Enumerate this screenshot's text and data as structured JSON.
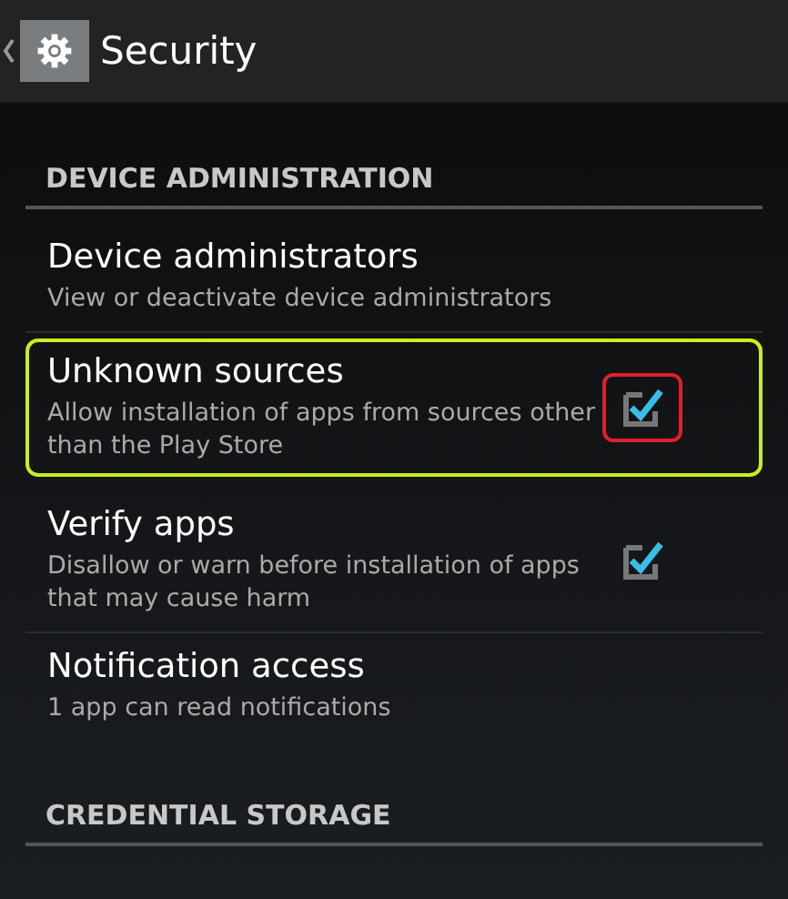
{
  "action_bar": {
    "title": "Security"
  },
  "sections": [
    {
      "header": "DEVICE ADMINISTRATION",
      "items": [
        {
          "kind": "link",
          "title": "Device administrators",
          "summary": "View or deactivate device administrators",
          "highlighted": false
        },
        {
          "kind": "checkbox",
          "title": "Unknown sources",
          "summary": "Allow installation of apps from sources other than the Play Store",
          "checked": true,
          "highlighted": true
        },
        {
          "kind": "checkbox",
          "title": "Verify apps",
          "summary": "Disallow or warn before installation of apps that may cause harm",
          "checked": true,
          "highlighted": false
        },
        {
          "kind": "link",
          "title": "Notification access",
          "summary": "1 app can read notifications",
          "highlighted": false
        }
      ]
    },
    {
      "header": "CREDENTIAL STORAGE"
    }
  ]
}
